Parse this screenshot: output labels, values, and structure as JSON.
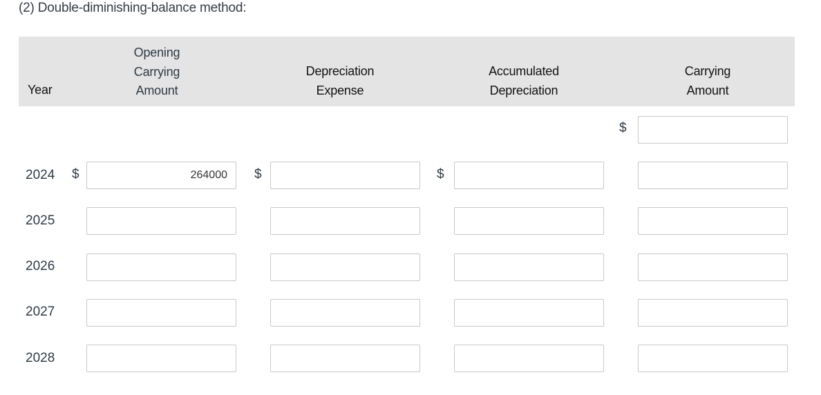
{
  "title": "(2) Double-diminishing-balance method:",
  "headers": {
    "year": "Year",
    "opening_line1": "Opening",
    "opening_line2": "Carrying",
    "opening_line3": "Amount",
    "depreciation_line1": "Depreciation",
    "depreciation_line2": "Expense",
    "accumulated_line1": "Accumulated",
    "accumulated_line2": "Depreciation",
    "carrying_line1": "Carrying",
    "carrying_line2": "Amount"
  },
  "currency_symbol": "$",
  "initial_row": {
    "carrying_amount": ""
  },
  "rows": [
    {
      "year": "2024",
      "opening": "264000",
      "depreciation": "",
      "accumulated": "",
      "carrying": ""
    },
    {
      "year": "2025",
      "opening": "",
      "depreciation": "",
      "accumulated": "",
      "carrying": ""
    },
    {
      "year": "2026",
      "opening": "",
      "depreciation": "",
      "accumulated": "",
      "carrying": ""
    },
    {
      "year": "2027",
      "opening": "",
      "depreciation": "",
      "accumulated": "",
      "carrying": ""
    },
    {
      "year": "2028",
      "opening": "",
      "depreciation": "",
      "accumulated": "",
      "carrying": ""
    }
  ]
}
